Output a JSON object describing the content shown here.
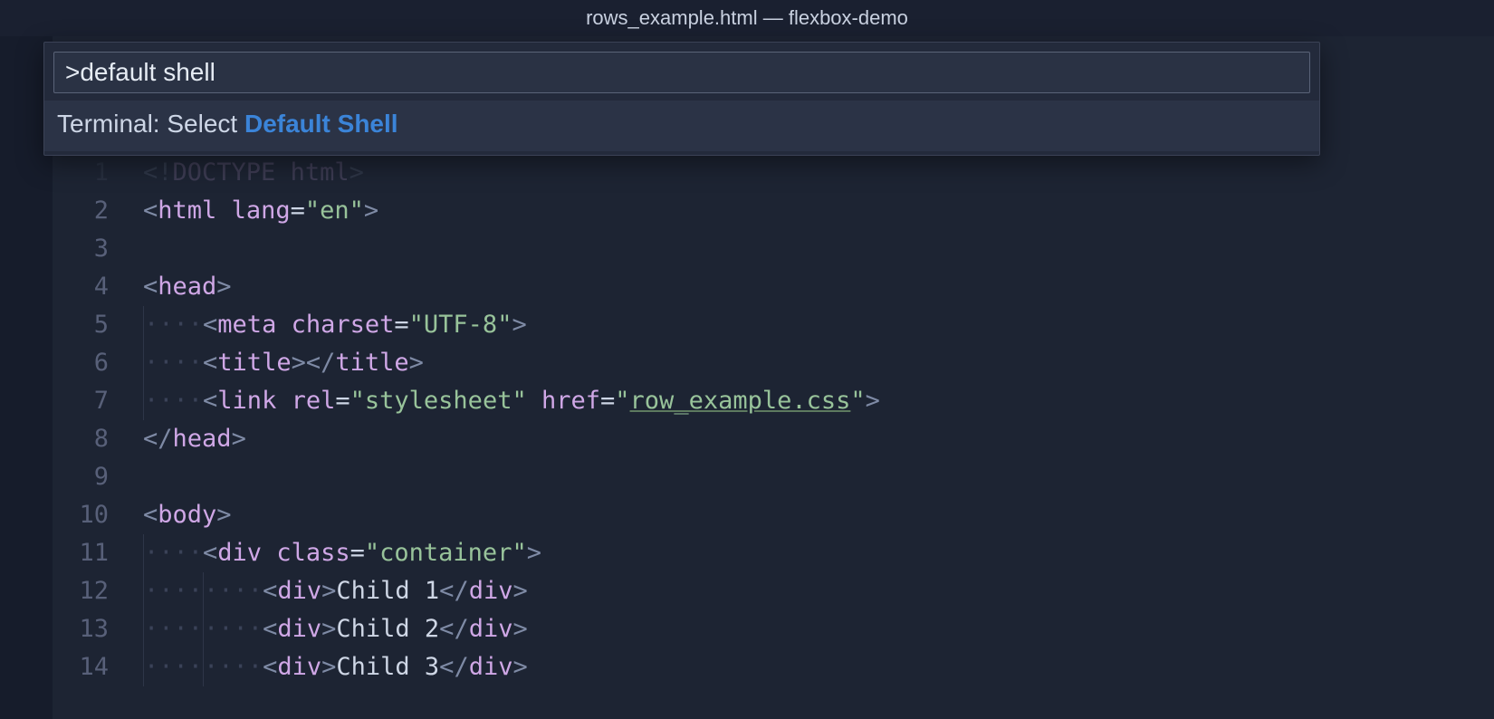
{
  "window": {
    "title": "rows_example.html — flexbox-demo"
  },
  "palette": {
    "input_value": ">default shell",
    "result_prefix": "Terminal: Select ",
    "result_highlight": "Default Shell"
  },
  "editor": {
    "lines": [
      {
        "n": 1
      },
      {
        "n": 2
      },
      {
        "n": 3
      },
      {
        "n": 4
      },
      {
        "n": 5
      },
      {
        "n": 6
      },
      {
        "n": 7
      },
      {
        "n": 8
      },
      {
        "n": 9
      },
      {
        "n": 10
      },
      {
        "n": 11
      },
      {
        "n": 12
      },
      {
        "n": 13
      },
      {
        "n": 14
      }
    ],
    "tokens": {
      "doctype_angle_open": "<!",
      "doctype_word": "DOCTYPE",
      "space": " ",
      "html_word": "html",
      "angle_close": ">",
      "open_angle": "<",
      "close_angle": ">",
      "slash": "/",
      "tag_html": "html",
      "attr_lang": "lang",
      "eq": "=",
      "val_en": "\"en\"",
      "tag_head": "head",
      "tag_meta": "meta",
      "attr_charset": "charset",
      "val_utf8": "\"UTF-8\"",
      "tag_title": "title",
      "tag_link": "link",
      "attr_rel": "rel",
      "val_stylesheet": "\"stylesheet\"",
      "attr_href": "href",
      "val_href_open_quote": "\"",
      "val_href_link": "row_example.css",
      "val_href_close_quote": "\"",
      "tag_body": "body",
      "tag_div": "div",
      "attr_class": "class",
      "val_container": "\"container\"",
      "txt_child1": "Child 1",
      "txt_child2": "Child 2",
      "txt_child3": "Child 3",
      "indent_dots4": "····",
      "indent_dots8": "········"
    }
  }
}
